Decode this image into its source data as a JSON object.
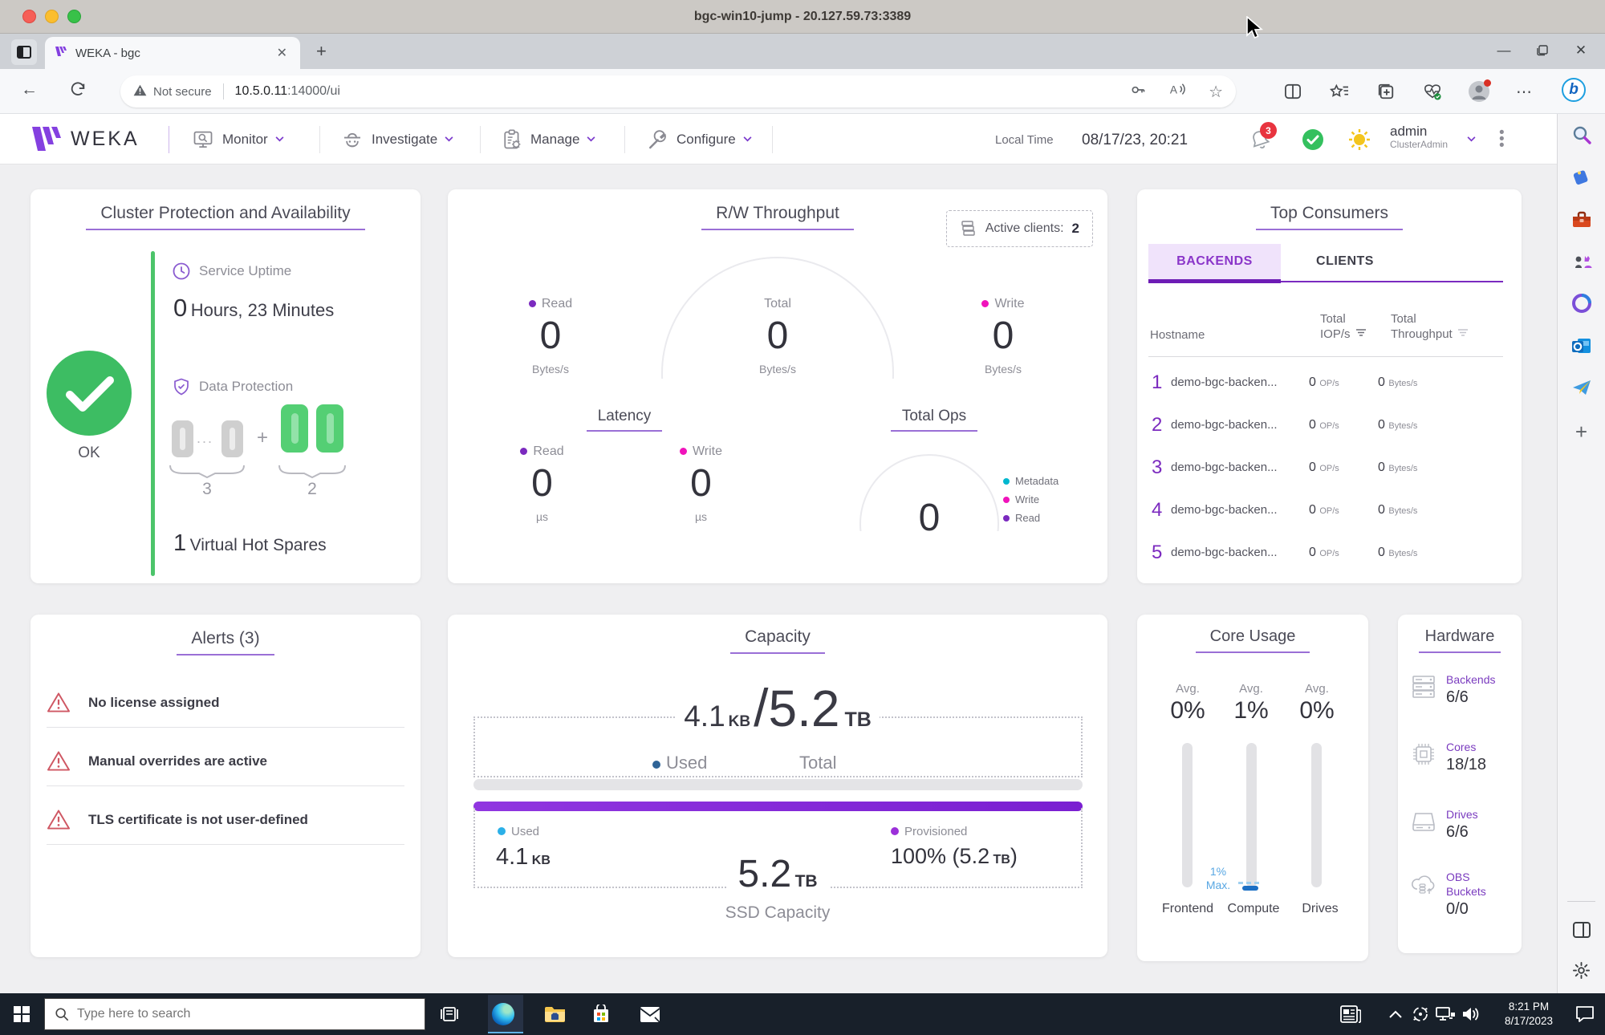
{
  "titlebar": {
    "title": "bgc-win10-jump - 20.127.59.73:3389"
  },
  "browser": {
    "tab": {
      "title": "WEKA - bgc"
    },
    "address": {
      "security": "Not secure",
      "host": "10.5.0.11",
      "path": ":14000/ui"
    }
  },
  "nav": {
    "brand": "WEKA",
    "menus": [
      {
        "label": "Monitor"
      },
      {
        "label": "Investigate"
      },
      {
        "label": "Manage"
      },
      {
        "label": "Configure"
      }
    ],
    "local_time_label": "Local Time",
    "local_time_value": "08/17/23, 20:21",
    "notification_count": "3",
    "user": {
      "name": "admin",
      "role": "ClusterAdmin"
    }
  },
  "cluster": {
    "title": "Cluster Protection and Availability",
    "status_label": "OK",
    "uptime_label": "Service Uptime",
    "uptime_number": "0",
    "uptime_text": "Hours, 23 Minutes",
    "protection_label": "Data Protection",
    "protection_dots": "...",
    "protection_plus": "+",
    "protection_left_count": "3",
    "protection_right_count": "2",
    "hot_spares_number": "1",
    "hot_spares_text": "Virtual Hot Spares"
  },
  "throughput": {
    "title": "R/W Throughput",
    "active_clients_label": "Active clients:",
    "active_clients_value": "2",
    "columns": [
      {
        "label": "Read",
        "value": "0",
        "unit": "Bytes/s"
      },
      {
        "label": "Total",
        "value": "0",
        "unit": "Bytes/s"
      },
      {
        "label": "Write",
        "value": "0",
        "unit": "Bytes/s"
      }
    ],
    "latency_title": "Latency",
    "latency_columns": [
      {
        "label": "Read",
        "value": "0",
        "unit": "µs"
      },
      {
        "label": "Write",
        "value": "0",
        "unit": "µs"
      }
    ],
    "total_ops_title": "Total Ops",
    "total_ops_value": "0",
    "legend": [
      {
        "label": "Metadata"
      },
      {
        "label": "Write"
      },
      {
        "label": "Read"
      }
    ]
  },
  "top_consumers": {
    "title": "Top Consumers",
    "tab_backends": "BACKENDS",
    "tab_clients": "CLIENTS",
    "header_hostname": "Hostname",
    "header_iops_1": "Total",
    "header_iops_2": "IOP/s",
    "header_tput_1": "Total",
    "header_tput_2": "Throughput",
    "rows": [
      {
        "rank": "1",
        "hostname": "demo-bgc-backen...",
        "iops": "0",
        "iops_unit": "OP/s",
        "tput": "0",
        "tput_unit": "Bytes/s"
      },
      {
        "rank": "2",
        "hostname": "demo-bgc-backen...",
        "iops": "0",
        "iops_unit": "OP/s",
        "tput": "0",
        "tput_unit": "Bytes/s"
      },
      {
        "rank": "3",
        "hostname": "demo-bgc-backen...",
        "iops": "0",
        "iops_unit": "OP/s",
        "tput": "0",
        "tput_unit": "Bytes/s"
      },
      {
        "rank": "4",
        "hostname": "demo-bgc-backen...",
        "iops": "0",
        "iops_unit": "OP/s",
        "tput": "0",
        "tput_unit": "Bytes/s"
      },
      {
        "rank": "5",
        "hostname": "demo-bgc-backen...",
        "iops": "0",
        "iops_unit": "OP/s",
        "tput": "0",
        "tput_unit": "Bytes/s"
      }
    ]
  },
  "alerts": {
    "title": "Alerts (3)",
    "items": [
      {
        "text": "No license assigned"
      },
      {
        "text": "Manual overrides are active"
      },
      {
        "text": "TLS certificate is not user-defined"
      }
    ]
  },
  "capacity": {
    "title": "Capacity",
    "used_value": "4.1",
    "used_unit": "KB",
    "slash": "/",
    "total_value": "5.2",
    "total_unit": "TB",
    "used_label": "Used",
    "total_label": "Total",
    "bottom_used_label": "Used",
    "bottom_used_value": "4.1",
    "bottom_used_unit": "KB",
    "ssd_value": "5.2",
    "ssd_unit": "TB",
    "ssd_caption": "SSD Capacity",
    "prov_label": "Provisioned",
    "prov_value": "100% (5.2",
    "prov_unit": "TB",
    "prov_close": ")"
  },
  "core_usage": {
    "title": "Core Usage",
    "avg_label": "Avg.",
    "columns": [
      {
        "value": "0%",
        "name": "Frontend"
      },
      {
        "value": "1%",
        "name": "Compute"
      },
      {
        "value": "0%",
        "name": "Drives"
      }
    ],
    "max_line1": "1%",
    "max_line2": "Max."
  },
  "hardware": {
    "title": "Hardware",
    "items": [
      {
        "label": "Backends",
        "value": "6/6"
      },
      {
        "label": "Cores",
        "value": "18/18"
      },
      {
        "label": "Drives",
        "value": "6/6"
      },
      {
        "label": "OBS Buckets",
        "value": "0/0"
      }
    ]
  },
  "taskbar": {
    "search_placeholder": "Type here to search",
    "time": "8:21 PM",
    "date": "8/17/2023"
  },
  "accents": {
    "brand_purple": "#7c3bcd",
    "underline_purple": "#9a6fd6",
    "tab_underline": "#6d1cb5",
    "magenta": "#f013bb",
    "purple_dot": "#7b2abf",
    "cyan": "#00b7cf",
    "steel_blue": "#2f6497",
    "bright_blue": "#2bb0e8",
    "green": "#3ec363",
    "alert_red": "#cf5763"
  }
}
